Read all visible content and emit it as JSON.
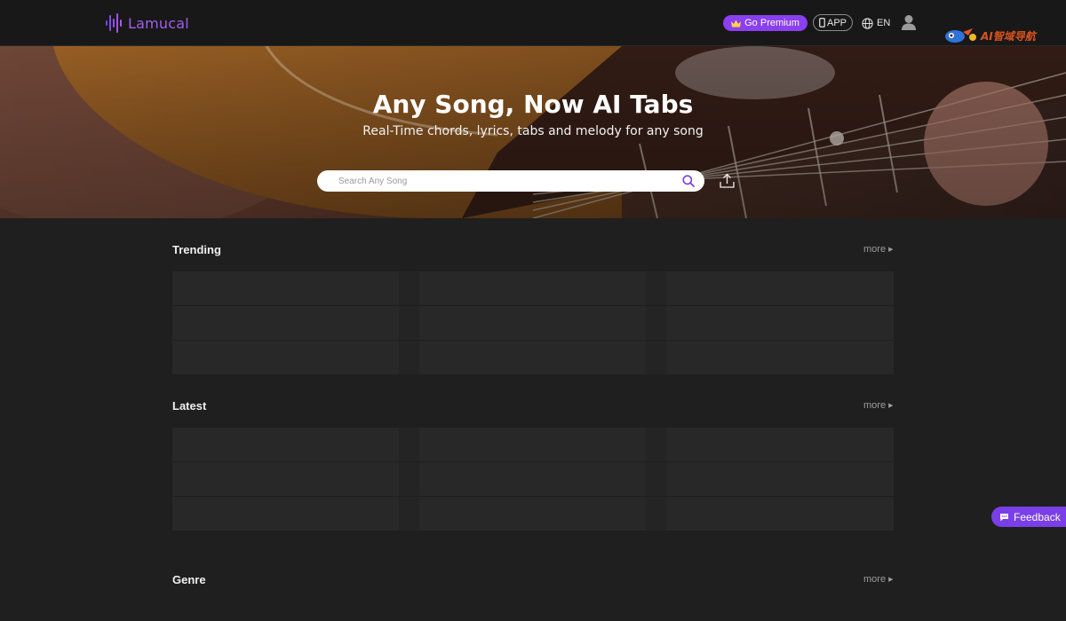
{
  "header": {
    "logo_text": "Lamucal",
    "premium_label": "Go Premium",
    "app_label": "APP",
    "language": "EN",
    "badge_text": "AI智域导航",
    "brand_color": "#8a3ff0"
  },
  "hero": {
    "title": "Any Song, Now AI Tabs",
    "subtitle": "Real-Time chords, lyrics, tabs and melody for any song",
    "search_placeholder": "Search Any Song"
  },
  "sections": [
    {
      "title": "Trending",
      "more_label": "more"
    },
    {
      "title": "Latest",
      "more_label": "more"
    },
    {
      "title": "Genre",
      "more_label": "more"
    }
  ],
  "feedback_label": "Feedback"
}
